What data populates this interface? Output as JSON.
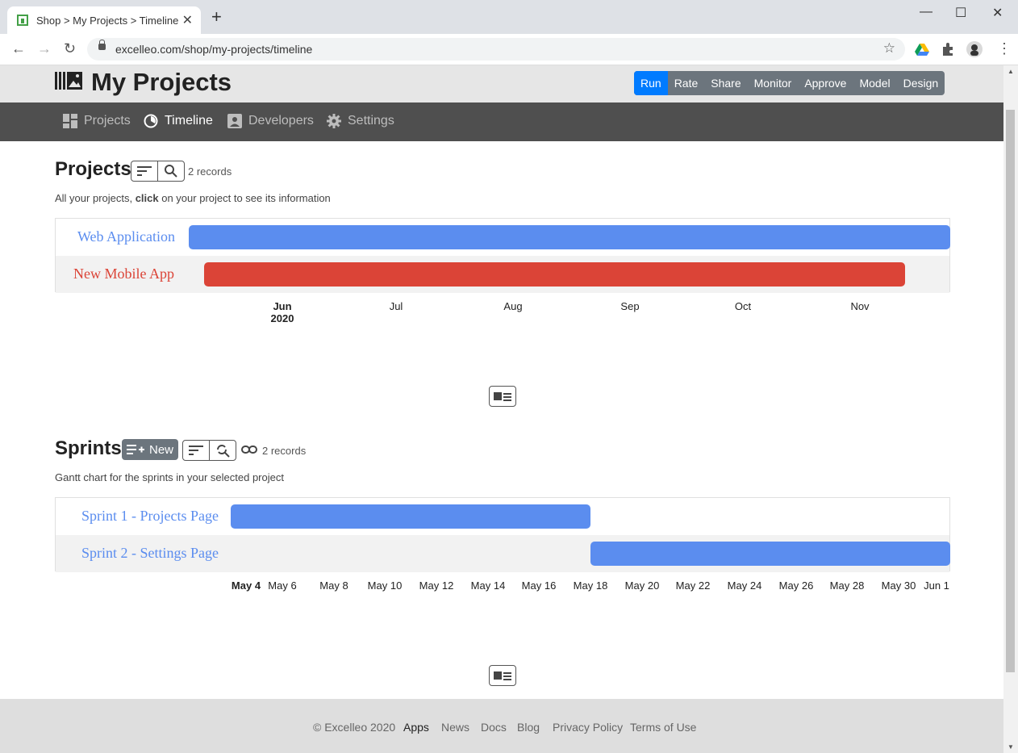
{
  "browser": {
    "tab_title": "Shop > My Projects > Timeline",
    "url": "excelleo.com/shop/my-projects/timeline",
    "new_tab": "+",
    "close": "✕",
    "minimize": "—",
    "maximize": "☐",
    "close_window": "✕"
  },
  "app": {
    "title": "My Projects",
    "modes": [
      "Run",
      "Rate",
      "Share",
      "Monitor",
      "Approve",
      "Model",
      "Design"
    ],
    "active_mode": "Run",
    "nav": [
      "Projects",
      "Timeline",
      "Developers",
      "Settings"
    ],
    "active_nav": "Timeline"
  },
  "projects": {
    "title": "Projects",
    "records": "2 records",
    "desc_before": "All your projects, ",
    "desc_bold": "click",
    "desc_after": " on your project to see its information",
    "rows": [
      {
        "label": "Web Application",
        "color": "#5b8def",
        "label_color": "#5b8def"
      },
      {
        "label": "New Mobile App",
        "color": "#db4437",
        "label_color": "#db4437"
      }
    ],
    "axis": [
      {
        "label": "Jun",
        "sub": "2020"
      },
      {
        "label": "Jul",
        "sub": ""
      },
      {
        "label": "Aug",
        "sub": ""
      },
      {
        "label": "Sep",
        "sub": ""
      },
      {
        "label": "Oct",
        "sub": ""
      },
      {
        "label": "Nov",
        "sub": ""
      }
    ]
  },
  "sprints": {
    "title": "Sprints",
    "new_label": "New",
    "records": "2 records",
    "desc": "Gantt chart for the sprints in your selected project",
    "rows": [
      {
        "label": "Sprint 1 - Projects Page",
        "color": "#5b8def"
      },
      {
        "label": "Sprint 2 - Settings Page",
        "color": "#5b8def"
      }
    ],
    "axis": [
      "May 4",
      "May 6",
      "May 8",
      "May 10",
      "May 12",
      "May 14",
      "May 16",
      "May 18",
      "May 20",
      "May 22",
      "May 24",
      "May 26",
      "May 28",
      "May 30",
      "Jun 1"
    ]
  },
  "footer": {
    "copyright": "© Excelleo 2020",
    "links": [
      "Apps",
      "News",
      "Docs",
      "Blog",
      "Privacy Policy",
      "Terms of Use"
    ]
  }
}
